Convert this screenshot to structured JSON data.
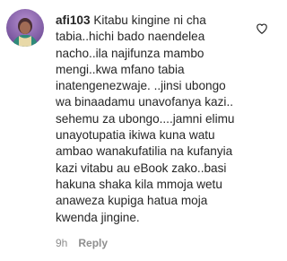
{
  "comment": {
    "username": "afi103",
    "text": " Kitabu kingine ni cha\ntabia..hichi bado naendelea\nnacho..ila najifunza mambo\nmengi..kwa mfano tabia\ninatengenezwaje. ..jinsi ubongo\nwa binaadamu unavofanya kazi..\nsehemu za ubongo....jamni elimu\nunayotupatia ikiwa kuna watu\nambao wanakufatilia na kufanyia\nkazi vitabu au eBook zako..basi\nhakuna shaka kila mmoja wetu\nanaweza kupiga hatua moja\nkwenda jingine.",
    "time": "9h",
    "reply_label": "Reply",
    "avatar_icon": "avatar-photo",
    "like_icon": "heart-outline-icon"
  }
}
